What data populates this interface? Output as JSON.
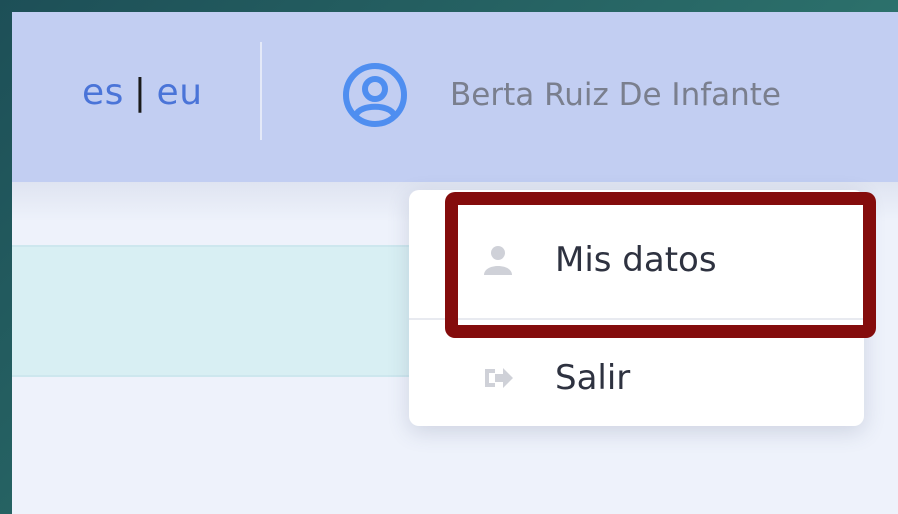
{
  "navbar": {
    "lang": {
      "es": "es",
      "separator": "|",
      "eu": "eu"
    },
    "user": {
      "name": "Berta Ruiz De Infante",
      "icon": "user-circle-icon"
    }
  },
  "dropdown": {
    "items": [
      {
        "label": "Mis datos",
        "icon": "user-icon"
      },
      {
        "label": "Salir",
        "icon": "sign-out-icon"
      }
    ]
  },
  "colors": {
    "navbar_bg": "#c2cef2",
    "link": "#4a74d8",
    "highlight": "#840c0c",
    "banner": "#d8eff3"
  }
}
